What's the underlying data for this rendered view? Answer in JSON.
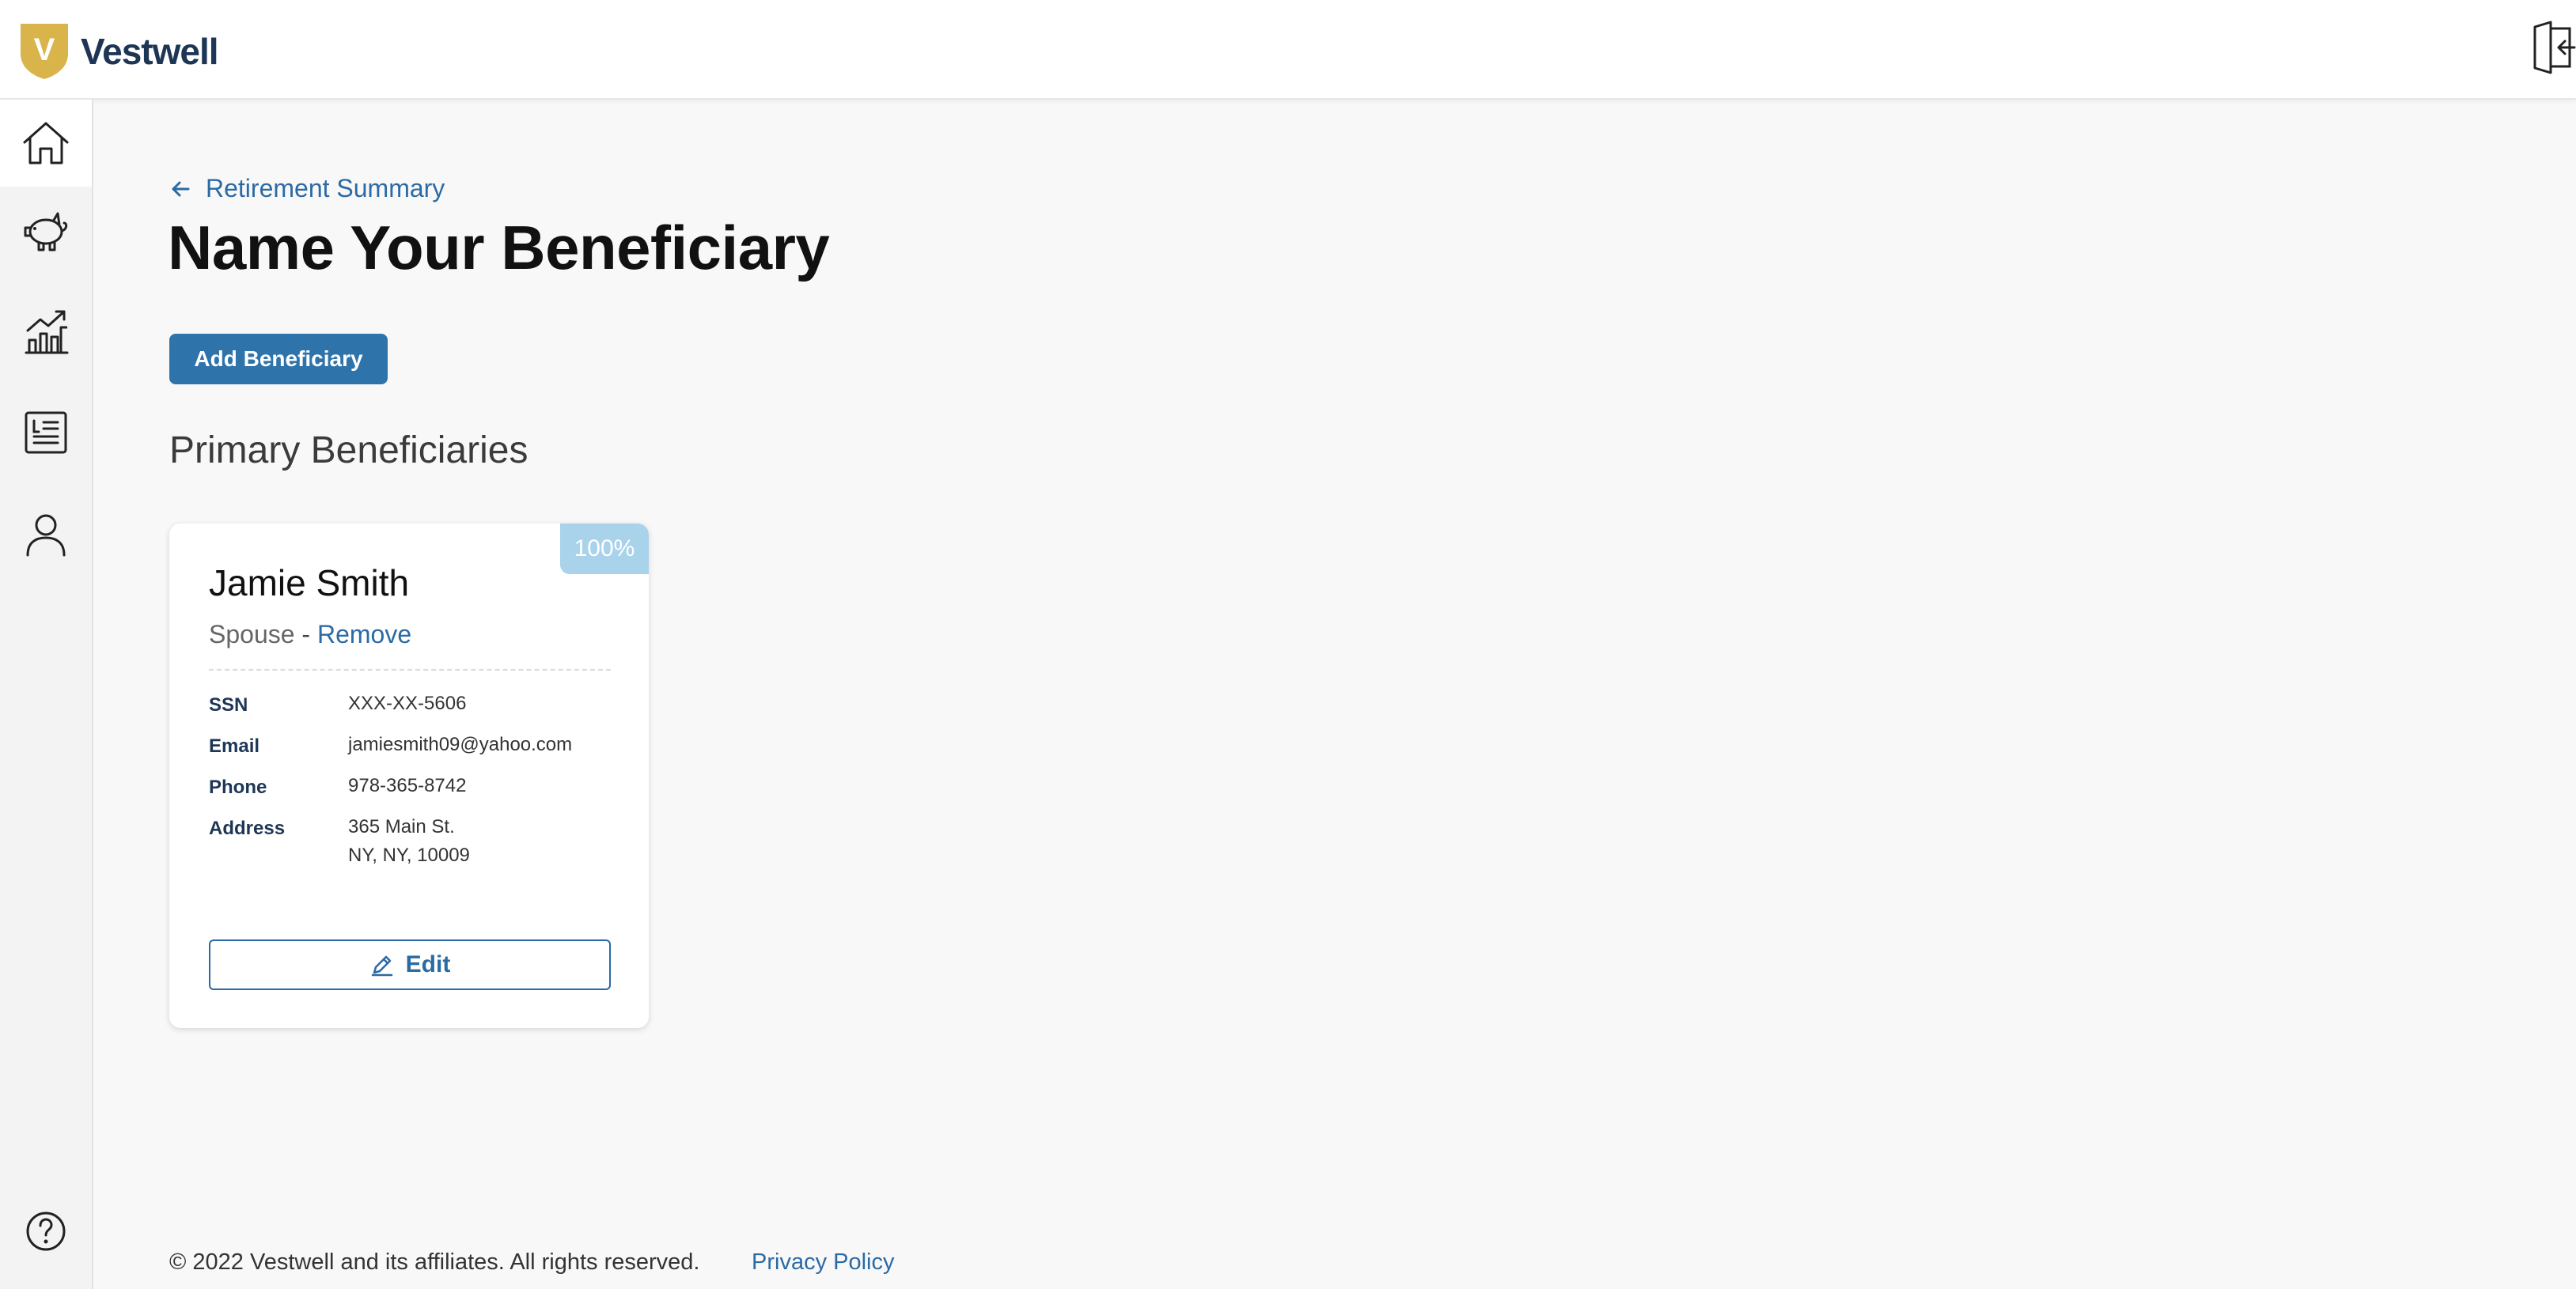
{
  "header": {
    "brand": "Vestwell",
    "logo_letter": "V",
    "logo_color": "#d9b44a",
    "logout_icon": "logout-icon"
  },
  "sidebar": {
    "items": [
      {
        "name": "home",
        "icon": "home-icon",
        "active": true
      },
      {
        "name": "savings",
        "icon": "piggy-bank-icon",
        "active": false
      },
      {
        "name": "investments",
        "icon": "chart-icon",
        "active": false
      },
      {
        "name": "documents",
        "icon": "document-icon",
        "active": false
      },
      {
        "name": "profile",
        "icon": "person-icon",
        "active": false
      },
      {
        "name": "help",
        "icon": "help-icon",
        "active": false
      }
    ]
  },
  "main": {
    "back_link": "Retirement Summary",
    "title": "Name Your Beneficiary",
    "add_button": "Add Beneficiary",
    "section_title": "Primary Beneficiaries"
  },
  "beneficiary": {
    "percentage": "100%",
    "name": "Jamie Smith",
    "relationship": "Spouse",
    "separator": "-",
    "remove_label": "Remove",
    "fields": [
      {
        "label": "SSN",
        "value": "XXX-XX-5606"
      },
      {
        "label": "Email",
        "value": "jamiesmith09@yahoo.com"
      },
      {
        "label": "Phone",
        "value": "978-365-8742"
      },
      {
        "label": "Address",
        "value_line1": "365 Main St.",
        "value_line2": "NY, NY, 10009"
      }
    ],
    "edit_label": "Edit"
  },
  "footer": {
    "copyright": "© 2022 Vestwell and its affiliates. All rights reserved.",
    "privacy_link": "Privacy Policy"
  },
  "colors": {
    "accent": "#2f73ab",
    "link": "#2b6aa5",
    "badge": "#a9d2eb",
    "brand_text": "#1e3655"
  }
}
